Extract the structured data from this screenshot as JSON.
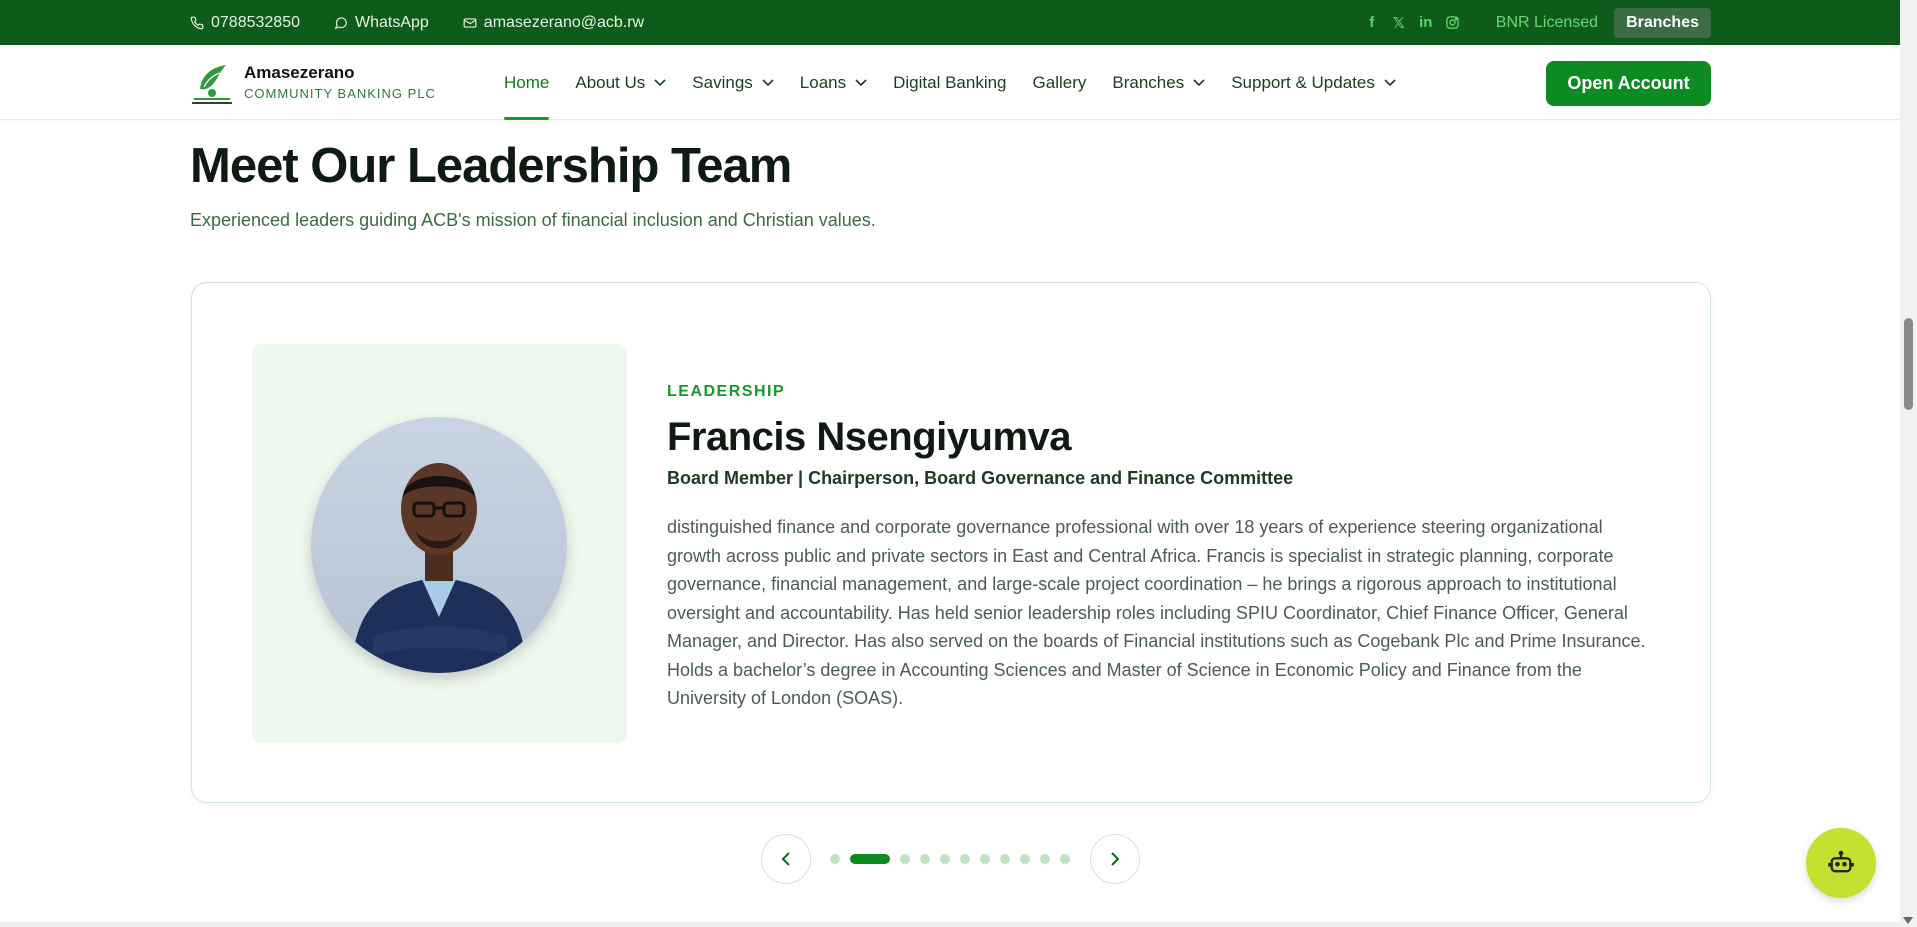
{
  "topbar": {
    "phone": "0788532850",
    "whatsapp": "WhatsApp",
    "email": "amasezerano@acb.rw",
    "social": [
      "facebook-icon",
      "x-icon",
      "linkedin-icon",
      "instagram-icon"
    ],
    "bnr": "BNR Licensed",
    "branches": "Branches"
  },
  "brand": {
    "name": "Amasezerano",
    "subtitle": "COMMUNITY BANKING PLC"
  },
  "nav": {
    "items": [
      {
        "label": "Home",
        "active": true,
        "dropdown": false
      },
      {
        "label": "About Us",
        "dropdown": true
      },
      {
        "label": "Savings",
        "dropdown": true
      },
      {
        "label": "Loans",
        "dropdown": true
      },
      {
        "label": "Digital Banking",
        "dropdown": false
      },
      {
        "label": "Gallery",
        "dropdown": false
      },
      {
        "label": "Branches",
        "dropdown": true
      },
      {
        "label": "Support & Updates",
        "dropdown": true
      }
    ],
    "cta": "Open Account"
  },
  "section": {
    "title": "Meet Our Leadership Team",
    "subtitle": "Experienced leaders guiding ACB's mission of financial inclusion and Christian values."
  },
  "leader": {
    "tag": "LEADERSHIP",
    "name": "Francis Nsengiyumva",
    "role": "Board Member | Chairperson, Board Governance and Finance Committee",
    "bio": "distinguished finance and corporate governance professional with over 18 years of experience steering organizational growth across public and private sectors in East and Central Africa. Francis is specialist in strategic planning, corporate governance, financial management, and large-scale project coordination – he brings a rigorous approach to institutional oversight and accountability. Has held senior leadership roles including SPIU Coordinator, Chief Finance Officer, General Manager, and Director. Has also served on the boards of Financial institutions such as Cogebank Plc and Prime Insurance. Holds a bachelor’s degree in Accounting Sciences and Master of Science in Economic Policy and Finance from the University of London (SOAS)."
  },
  "carousel": {
    "total": 11,
    "current": 2
  },
  "colors": {
    "topbar": "#0f5c1a",
    "accent": "#0d8a21",
    "chat": "#c5e030"
  }
}
